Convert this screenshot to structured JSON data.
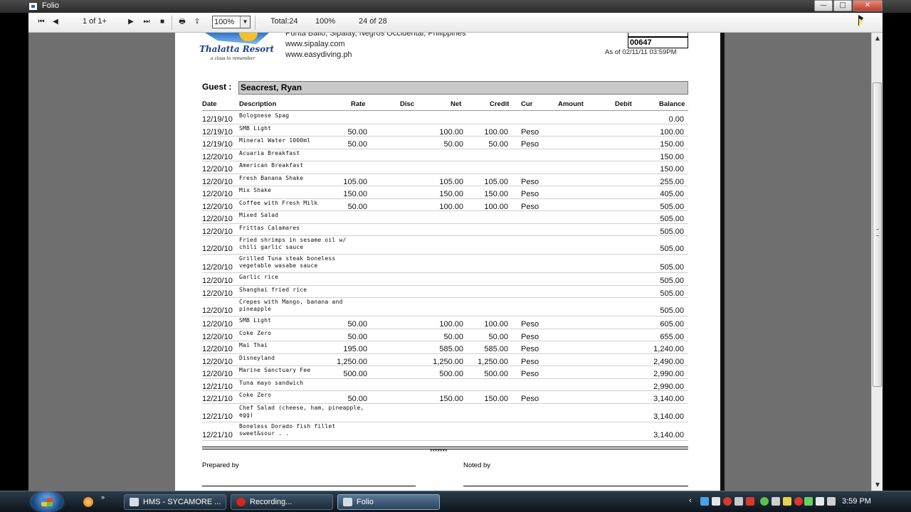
{
  "window": {
    "title": "Folio",
    "buttons": {
      "minimize": "—",
      "maximize": "□",
      "close": "✕"
    }
  },
  "toolbar": {
    "page_indicator": "1 of 1+",
    "zoom_value": "100%",
    "total": "Total:24",
    "percent": "100%",
    "record_count": "24 of 28"
  },
  "report": {
    "logo_text": "Thalatta Resort",
    "logo_tagline": "a class to remember",
    "address_line": "Punta Ballo, Sipalay, Negros Occidental, Philippines",
    "website1": "www.sipalay.com",
    "website2": "www.easydiving.ph",
    "folio_number": "00647",
    "as_of": "As of 02/11/11  03:59PM",
    "guest_label": "Guest :",
    "guest_name": "Seacrest, Ryan",
    "columns": {
      "date": "Date",
      "description": "Description",
      "rate": "Rate",
      "disc": "Disc",
      "net": "Net",
      "credit": "Credit",
      "cur": "Cur",
      "amount": "Amount",
      "debit": "Debit",
      "balance": "Balance"
    },
    "rows": [
      {
        "date": "12/19/10",
        "desc": "Bolognese Spag",
        "rate": "",
        "net": "",
        "credit": "",
        "cur": "",
        "bal": "0.00"
      },
      {
        "date": "12/19/10",
        "desc": "SMB Light",
        "rate": "50.00",
        "net": "100.00",
        "credit": "100.00",
        "cur": "Peso",
        "bal": "100.00"
      },
      {
        "date": "12/19/10",
        "desc": "Mineral Water 1000ml",
        "rate": "50.00",
        "net": "50.00",
        "credit": "50.00",
        "cur": "Peso",
        "bal": "150.00"
      },
      {
        "date": "12/20/10",
        "desc": "Acuaria Breakfast",
        "rate": "",
        "net": "",
        "credit": "",
        "cur": "",
        "bal": "150.00"
      },
      {
        "date": "12/20/10",
        "desc": "American Breakfast",
        "rate": "",
        "net": "",
        "credit": "",
        "cur": "",
        "bal": "150.00"
      },
      {
        "date": "12/20/10",
        "desc": "Fresh Banana Shake",
        "rate": "105.00",
        "net": "105.00",
        "credit": "105.00",
        "cur": "Peso",
        "bal": "255.00"
      },
      {
        "date": "12/20/10",
        "desc": "Mix Shake",
        "rate": "150.00",
        "net": "150.00",
        "credit": "150.00",
        "cur": "Peso",
        "bal": "405.00"
      },
      {
        "date": "12/20/10",
        "desc": "Coffee with Fresh Milk",
        "rate": "50.00",
        "net": "100.00",
        "credit": "100.00",
        "cur": "Peso",
        "bal": "505.00"
      },
      {
        "date": "12/20/10",
        "desc": "Mixed Salad",
        "rate": "",
        "net": "",
        "credit": "",
        "cur": "",
        "bal": "505.00"
      },
      {
        "date": "12/20/10",
        "desc": "Frittas Calamares",
        "rate": "",
        "net": "",
        "credit": "",
        "cur": "",
        "bal": "505.00"
      },
      {
        "date": "12/20/10",
        "desc": "Fried shrimps in sesame oil w/ chili garlic sauce",
        "rate": "",
        "net": "",
        "credit": "",
        "cur": "",
        "bal": "505.00"
      },
      {
        "date": "12/20/10",
        "desc": "Grilled Tuna steak boneless vegetable wasabe sauce",
        "rate": "",
        "net": "",
        "credit": "",
        "cur": "",
        "bal": "505.00"
      },
      {
        "date": "12/20/10",
        "desc": "Garlic rice",
        "rate": "",
        "net": "",
        "credit": "",
        "cur": "",
        "bal": "505.00"
      },
      {
        "date": "12/20/10",
        "desc": "Shanghai fried rice",
        "rate": "",
        "net": "",
        "credit": "",
        "cur": "",
        "bal": "505.00"
      },
      {
        "date": "12/20/10",
        "desc": "Crepes with Mango, banana and pineapple",
        "rate": "",
        "net": "",
        "credit": "",
        "cur": "",
        "bal": "505.00"
      },
      {
        "date": "12/20/10",
        "desc": "SMB Light",
        "rate": "50.00",
        "net": "100.00",
        "credit": "100.00",
        "cur": "Peso",
        "bal": "605.00"
      },
      {
        "date": "12/20/10",
        "desc": "Coke Zero",
        "rate": "50.00",
        "net": "50.00",
        "credit": "50.00",
        "cur": "Peso",
        "bal": "655.00"
      },
      {
        "date": "12/20/10",
        "desc": "Mai Thai",
        "rate": "195.00",
        "net": "585.00",
        "credit": "585.00",
        "cur": "Peso",
        "bal": "1,240.00"
      },
      {
        "date": "12/20/10",
        "desc": "Disneyland",
        "rate": "1,250.00",
        "net": "1,250.00",
        "credit": "1,250.00",
        "cur": "Peso",
        "bal": "2,490.00"
      },
      {
        "date": "12/20/10",
        "desc": "Marine Sanctuary Fee",
        "rate": "500.00",
        "net": "500.00",
        "credit": "500.00",
        "cur": "Peso",
        "bal": "2,990.00"
      },
      {
        "date": "12/21/10",
        "desc": "Tuna mayo sandwich",
        "rate": "",
        "net": "",
        "credit": "",
        "cur": "",
        "bal": "2,990.00"
      },
      {
        "date": "12/21/10",
        "desc": "Coke Zero",
        "rate": "50.00",
        "net": "150.00",
        "credit": "150.00",
        "cur": "Peso",
        "bal": "3,140.00"
      },
      {
        "date": "12/21/10",
        "desc": "Chef Salad (cheese, ham, pineapple, egg)",
        "rate": "",
        "net": "",
        "credit": "",
        "cur": "",
        "bal": "3,140.00"
      },
      {
        "date": "12/21/10",
        "desc": "Boneless Dorado fish fillet sweet&sour . .",
        "rate": "",
        "net": "",
        "credit": "",
        "cur": "",
        "bal": "3,140.00"
      }
    ],
    "end_marker": "*******",
    "prepared_by": "Prepared by",
    "noted_by": "Noted by"
  },
  "taskbar": {
    "tasks": [
      {
        "label": "HMS - SYCAMORE ..."
      },
      {
        "label": "Recording..."
      },
      {
        "label": "Folio"
      }
    ],
    "quicklaunch_more": "»",
    "tray_arrow": "‹",
    "clock": "3:59 PM"
  }
}
